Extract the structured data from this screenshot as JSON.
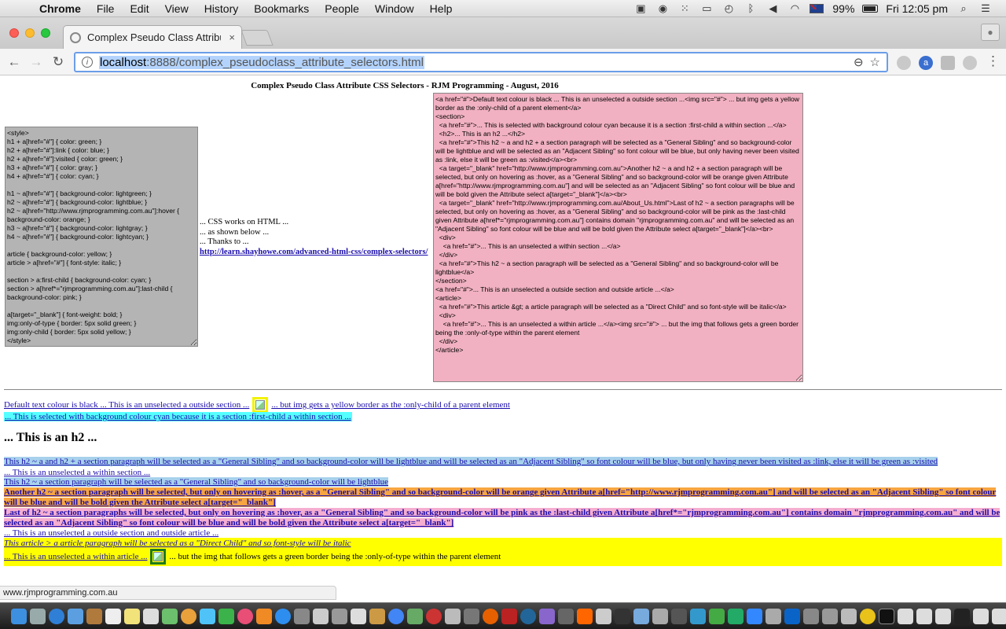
{
  "menubar": {
    "app": "Chrome",
    "items": [
      "File",
      "Edit",
      "View",
      "History",
      "Bookmarks",
      "People",
      "Window",
      "Help"
    ],
    "battery": "99%",
    "clock": "Fri 12:05 pm"
  },
  "tab": {
    "title": "Complex Pseudo Class Attribu",
    "close": "×"
  },
  "address": {
    "host": "localhost",
    "path": ":8888/complex_pseudoclass_attribute_selectors.html"
  },
  "page": {
    "title": "Complex Pseudo Class Attribute CSS Selectors - RJM Programming - August, 2016",
    "css_code": "<style>\nh1 + a[href=\"#\"] { color: green; }\nh2 + a[href=\"#\"]:link { color: blue; }\nh2 + a[href=\"#\"]:visited { color: green; }\nh3 + a[href=\"#\"] { color: gray; }\nh4 + a[href=\"#\"] { color: cyan; }\n\nh1 ~ a[href=\"#\"] { background-color: lightgreen; }\nh2 ~ a[href=\"#\"] { background-color: lightblue; }\nh2 ~ a[href=\"http://www.rjmprogramming.com.au\"]:hover { background-color: orange; }\nh3 ~ a[href=\"#\"] { background-color: lightgray; }\nh4 ~ a[href=\"#\"] { background-color: lightcyan; }\n\narticle { background-color: yellow; }\narticle > a[href=\"#\"] { font-style: italic; }\n\nsection > a:first-child { background-color: cyan; }\nsection > a[href*=\"rjmprogramming.com.au\"]:last-child { background-color: pink; }\n\na[target=\"_blank\"] { font-weight: bold; }\nimg:only-of-type { border: 5px solid green; }\nimg:only-child { border: 5px solid yellow; }\n</style>",
    "middle": {
      "l1": "... CSS works on HTML ...",
      "l2": "... as shown below ...",
      "l3": "... Thanks to ...",
      "link": "http://learn.shayhowe.com/advanced-html-css/complex-selectors/"
    },
    "html_code": "<a href=\"#\">Default text colour is black ... This is an unselected a outside section ...<img src=\"#\"> ... but img gets a yellow border as the :only-child of a parent element</a>\n<section>\n  <a href=\"#\">... This is selected with background colour cyan because it is a section :first-child a within section ...</a>\n  <h2>... This is an h2 ...</h2>\n  <a href=\"#\">This h2 ~ a and h2 + a section paragraph will be selected as a \"General Sibling\" and so background-color will be lightblue and will be selected as an \"Adjacent Sibling\" so font colour will be blue, but only having never been visited as :link, else it will be green as :visited</a><br>\n  <a target=\"_blank\" href=\"http://www.rjmprogramming.com.au\">Another h2 ~ a and h2 + a section paragraph will be selected, but only on hovering as :hover, as a \"General Sibling\" and so background-color will be orange given Attribute a[href=\"http://www.rjmprogramming.com.au\"] and will be selected as an \"Adjacent Sibling\" so font colour will be blue and will be bold given the Attribute select a[target=\"_blank\"]</a><br>\n  <a target=\"_blank\" href=\"http://www.rjmprogramming.com.au/About_Us.html\">Last of h2 ~ a section paragraphs will be selected, but only on hovering as :hover, as a \"General Sibling\" and so background-color will be pink as the :last-child given Attribute a[href*=\"rjmprogramming.com.au\"] contains domain \"rjmprogramming.com.au\" and will be selected as an \"Adjacent Sibling\" so font colour will be blue and will be bold given the Attribute select a[target=\"_blank\"]</a><br>\n  <div>\n    <a href=\"#\">... This is an unselected a within section ...</a>\n  </div>\n  <a href=\"#\">This h2 ~ a section paragraph will be selected as a \"General Sibling\" and so background-color will be lightblue</a>\n</section>\n<a href=\"#\">... This is an unselected a outside section and outside article ...</a>\n<article>\n  <a href=\"#\">This article &gt; a article paragraph will be selected as a \"Direct Child\" and so font-style will be italic</a>\n  <div>\n    <a href=\"#\">... This is an unselected a within article ...</a><img src=\"#\"> ... but the img that follows gets a green border being the :only-of-type within the parent element\n  </div>\n</article>",
    "demo": {
      "l1a": "Default text colour is black ... This is an unselected a outside section ...",
      "l1b": " ... but img gets a yellow border as the :only-child of a parent element",
      "l2": "... This is selected with background colour cyan because it is a section :first-child a within section ...",
      "h2": "... This is an h2 ...",
      "l3": "This h2 ~ a and h2 + a section paragraph will be selected as a \"General Sibling\" and so background-color will be lightblue and will be selected as an \"Adjacent Sibling\" so font colour will be blue, but only having never been visited as :link, else it will be green as :visited",
      "l4": "... This is an unselected a within section ...",
      "l5": "This h2 ~ a section paragraph will be selected as a \"General Sibling\" and so background-color will be lightblue",
      "l6": "Another h2 ~ a section paragraph will be selected, but only on hovering as :hover, as a \"General Sibling\" and so background-color will be orange given Attribute a[href=\"http://www.rjmprogramming.com.au\"] and will be selected as an \"Adjacent Sibling\" so font colour will be blue and will be bold given the Attribute select a[target=\"_blank\"]",
      "l7": "Last of h2 ~ a section paragraphs will be selected, but only on hovering as :hover, as a \"General Sibling\" and so background-color will be pink as the :last-child given Attribute a[href*=\"rjmprogramming.com.au\"] contains domain \"rjmprogramming.com.au\" and will be selected as an \"Adjacent Sibling\" so font colour will be blue and will be bold given the Attribute select a[target=\"_blank\"]",
      "l8": "... This is an unselected a outside section and outside article ...",
      "l9": "This article > a article paragraph will be selected as a \"Direct Child\" and so font-style will be italic",
      "l10a": "... This is an unselected a within article ...",
      "l10b": " ... but the img that follows gets a green border being the :only-of-type within the parent element"
    }
  },
  "status_bar": "www.rjmprogramming.com.au",
  "colors": {
    "css_box": "#b4b4b4",
    "html_box": "#f1b1c2",
    "cyan": "#55ffff",
    "lightblue": "#a7d1ec",
    "orange": "#f7a541",
    "pink": "#f5aed0",
    "yellow": "#ffff00"
  },
  "dock_icons": [
    "finder",
    "launchpad",
    "safari",
    "mail",
    "contacts",
    "calendar",
    "notes",
    "reminders",
    "maps",
    "photos",
    "messages",
    "facetime",
    "itunes",
    "ibooks",
    "app-store",
    "system-preferences",
    "chrome",
    "firefox",
    "opera",
    "terminal",
    "filezilla",
    "xcode",
    "other"
  ]
}
